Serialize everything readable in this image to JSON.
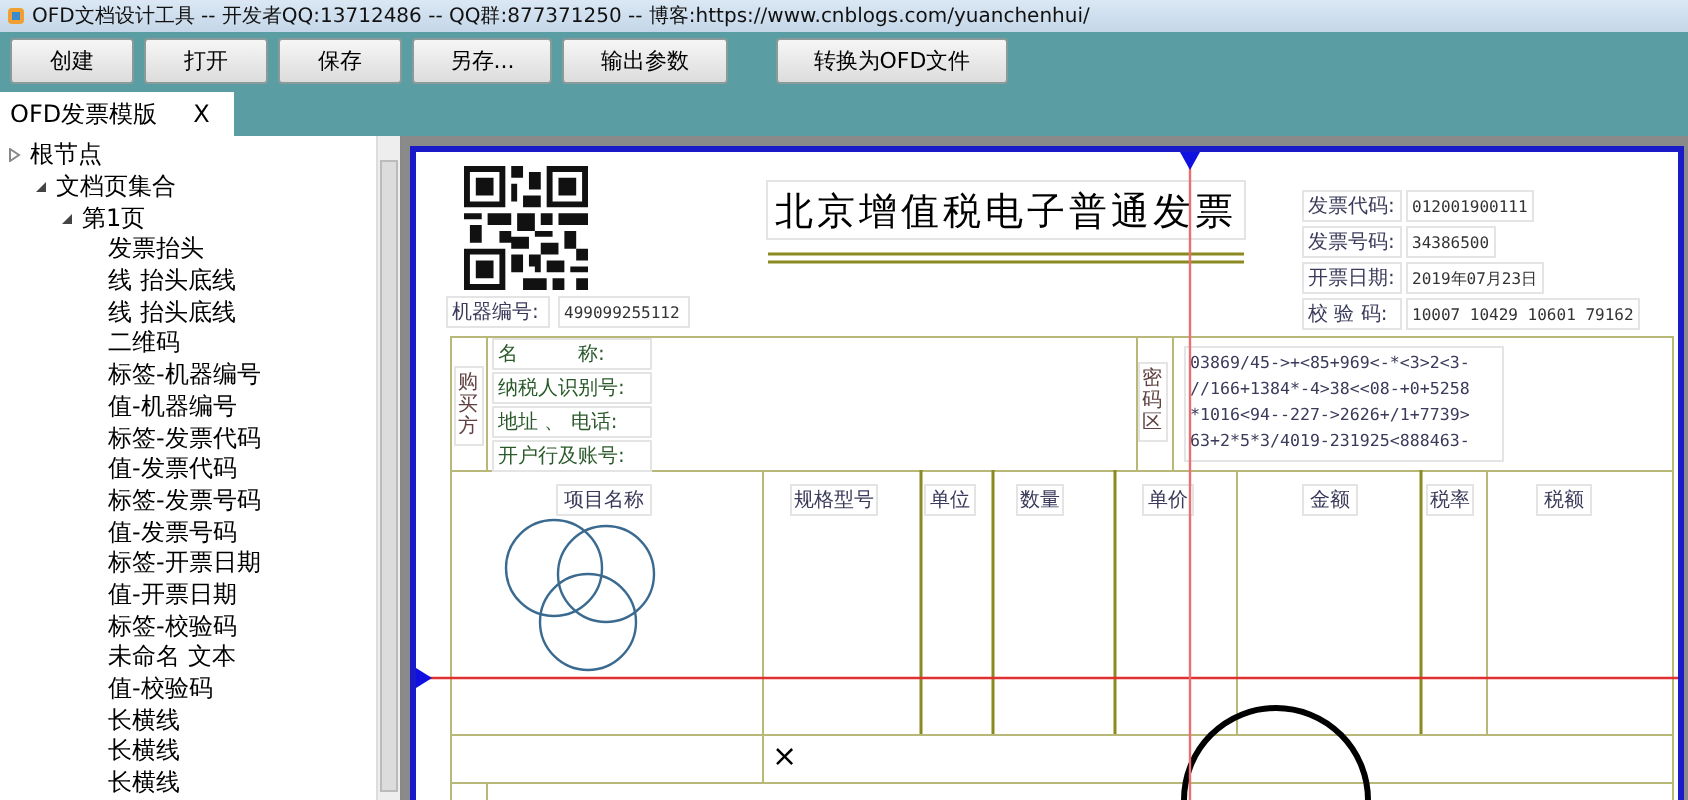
{
  "window": {
    "title": "OFD文档设计工具 -- 开发者QQ:13712486 -- QQ群:877371250 -- 博客:https://www.cnblogs.com/yuanchenhui/"
  },
  "toolbar": {
    "buttons": [
      "创建",
      "打开",
      "保存",
      "另存...",
      "输出参数",
      "转换为OFD文件"
    ]
  },
  "tabs": [
    {
      "label": "OFD发票模版",
      "close": "X",
      "selected": true
    }
  ],
  "tree": [
    {
      "label": "根节点",
      "expanded": false,
      "children": [
        {
          "label": "文档页集合",
          "expanded": true,
          "children": [
            {
              "label": "第1页",
              "expanded": true,
              "children": [
                {
                  "label": "发票抬头"
                },
                {
                  "label": "线 抬头底线"
                },
                {
                  "label": "线 抬头底线"
                },
                {
                  "label": "二维码"
                },
                {
                  "label": "标签-机器编号"
                },
                {
                  "label": "值-机器编号"
                },
                {
                  "label": "标签-发票代码"
                },
                {
                  "label": "值-发票代码"
                },
                {
                  "label": "标签-发票号码"
                },
                {
                  "label": "值-发票号码"
                },
                {
                  "label": "标签-开票日期"
                },
                {
                  "label": "值-开票日期"
                },
                {
                  "label": "标签-校验码"
                },
                {
                  "label": "未命名 文本"
                },
                {
                  "label": "值-校验码"
                },
                {
                  "label": "长横线"
                },
                {
                  "label": "长横线"
                },
                {
                  "label": "长横线"
                }
              ]
            }
          ]
        }
      ]
    }
  ],
  "invoice": {
    "title": "北京增值税电子普通发票",
    "machine_no": {
      "label": "机器编号:",
      "value": "499099255112"
    },
    "header_fields": [
      {
        "label": "发票代码:",
        "value": "012001900111"
      },
      {
        "label": "发票号码:",
        "value": "34386500"
      },
      {
        "label": "开票日期:",
        "value": "2019年07月23日"
      },
      {
        "label": "校 验 码:",
        "value": "10007 10429 10601 79162"
      }
    ],
    "buyer": {
      "side_label": "购买方",
      "fields": [
        "名　　　称:",
        "纳税人识别号:",
        "地址 、 电话:",
        "开户行及账号:"
      ]
    },
    "cipher": {
      "label": "密码区",
      "lines": [
        "03869/45->+<85+969<-*<3>2<3-",
        "//166+1384*-4>38<<08-+0+5258",
        "*1016<94--227->2626+/1+7739>",
        "63+2*5*3/4019-231925<888463-"
      ]
    },
    "columns": [
      "项目名称",
      "规格型号",
      "单位",
      "数量",
      "单价",
      "金额",
      "税率",
      "税额"
    ],
    "mark": "×"
  }
}
